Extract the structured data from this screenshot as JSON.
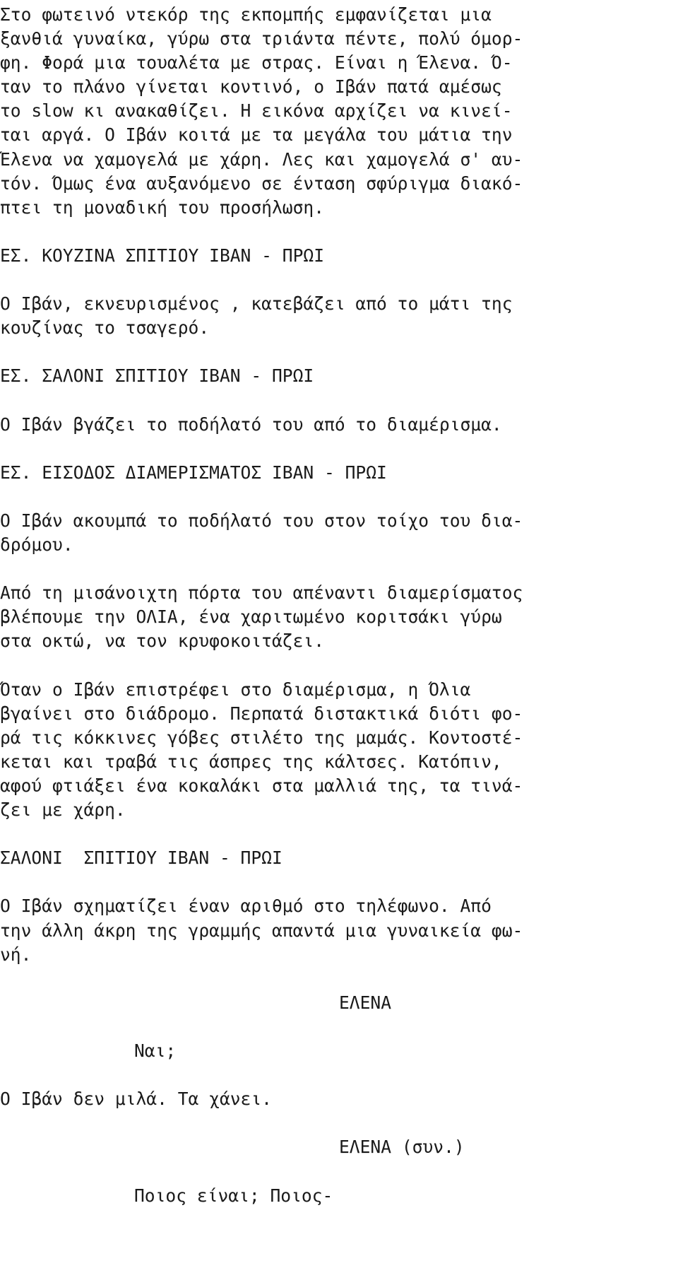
{
  "document": {
    "type": "screenplay",
    "language": "el",
    "page_background": "#ffffff",
    "text_color": "#1a1a1a"
  },
  "blocks": [
    {
      "kind": "action",
      "lines": [
        "Στο φωτεινό ντεκόρ της εκπομπής εμφανίζεται μια",
        "ξανθιά γυναίκα, γύρω στα τριάντα πέντε, πολύ όμορ-",
        "φη. Φορά μια τουαλέτα με στρας. Είναι η Έλενα. Ό-",
        "ταν το πλάνο γίνεται κοντινό, ο Ιβάν πατά αμέσως",
        "το slow κι ανακαθίζει. Η εικόνα αρχίζει να κινεί-",
        "ται αργά. Ο Ιβάν κοιτά με τα μεγάλα του μάτια την",
        "Έλενα να χαμογελά με χάρη. Λες και χαμογελά σ' αυ-",
        "τόν. Όμως ένα αυξανόμενο σε ένταση σφύριγμα διακό-",
        "πτει τη μοναδική του προσήλωση."
      ]
    },
    {
      "kind": "slug",
      "lines": [
        "ΕΣ. ΚΟΥΖΙΝΑ ΣΠΙΤΙΟΥ ΙΒΑΝ - ΠΡΩΙ"
      ]
    },
    {
      "kind": "action",
      "lines": [
        "Ο Ιβάν, εκνευρισμένος , κατεβάζει από το μάτι της",
        "κουζίνας το τσαγερό."
      ]
    },
    {
      "kind": "slug",
      "lines": [
        "ΕΣ. ΣΑΛΟΝΙ ΣΠΙΤΙΟΥ ΙΒΑΝ - ΠΡΩΙ"
      ]
    },
    {
      "kind": "action",
      "lines": [
        "Ο Ιβάν βγάζει το ποδήλατό του από το διαμέρισμα."
      ]
    },
    {
      "kind": "slug",
      "lines": [
        "ΕΣ. ΕΙΣΟΔΟΣ ΔΙΑΜΕΡΙΣΜΑΤΟΣ ΙΒΑΝ - ΠΡΩΙ"
      ]
    },
    {
      "kind": "action",
      "lines": [
        "Ο Ιβάν ακουμπά το ποδήλατό του στον τοίχο του δια-",
        "δρόμου."
      ]
    },
    {
      "kind": "action",
      "lines": [
        "Από τη μισάνοιχτη πόρτα του απέναντι διαμερίσματος",
        "βλέπουμε την ΟΛΙΑ, ένα χαριτωμένο κοριτσάκι γύρω",
        "στα οκτώ, να τον κρυφοκοιτάζει."
      ]
    },
    {
      "kind": "action",
      "lines": [
        "Όταν ο Ιβάν επιστρέφει στο διαμέρισμα, η Όλια",
        "βγαίνει στο διάδρομο. Περπατά διστακτικά διότι φο-",
        "ρά τις κόκκινες γόβες στιλέτο της μαμάς. Κοντοστέ-",
        "κεται και τραβά τις άσπρες της κάλτσες. Κατόπιν,",
        "αφού φτιάξει ένα κοκαλάκι στα μαλλιά της, τα τινά-",
        "ζει με χάρη."
      ]
    },
    {
      "kind": "slug",
      "lines": [
        "ΣΑΛΟΝΙ  ΣΠΙΤΙΟΥ ΙΒΑΝ - ΠΡΩΙ"
      ]
    },
    {
      "kind": "action",
      "lines": [
        "Ο Ιβάν σχηματίζει έναν αριθμό στο τηλέφωνο. Από",
        "την άλλη άκρη της γραμμής απαντά μια γυναικεία φω-",
        "νή."
      ]
    },
    {
      "kind": "character",
      "lines": [
        "ΕΛΕΝΑ"
      ]
    },
    {
      "kind": "dialogue",
      "lines": [
        "Ναι;"
      ]
    },
    {
      "kind": "action",
      "lines": [
        "Ο Ιβάν δεν μιλά. Τα χάνει."
      ]
    },
    {
      "kind": "character",
      "lines": [
        "ΕΛΕΝΑ (συν.)"
      ]
    },
    {
      "kind": "dialogue",
      "lines": [
        "Ποιος είναι; Ποιος-"
      ]
    }
  ]
}
